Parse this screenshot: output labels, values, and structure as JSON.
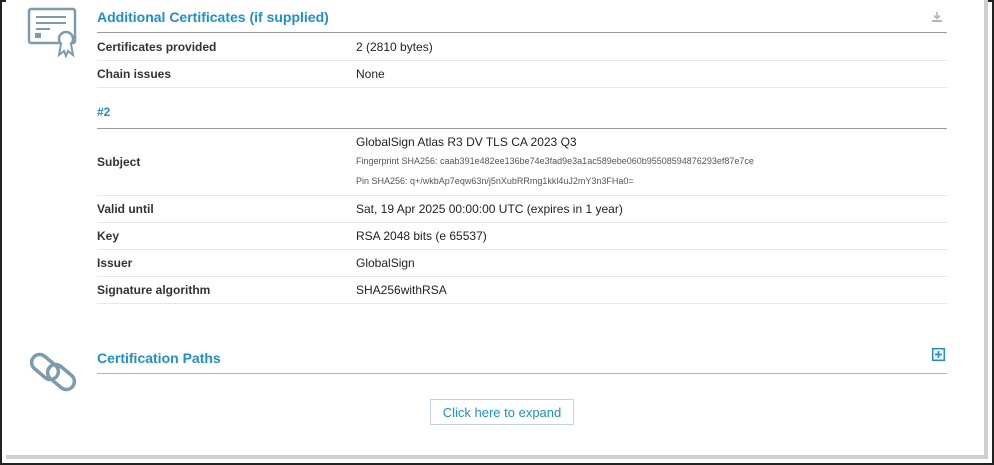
{
  "additional_certificates": {
    "title": "Additional Certificates (if supplied)",
    "rows": [
      {
        "label": "Certificates provided",
        "value": "2 (2810 bytes)"
      },
      {
        "label": "Chain issues",
        "value": "None"
      }
    ],
    "cert2": {
      "heading": "#2",
      "subject_label": "Subject",
      "subject_value": "GlobalSign Atlas R3 DV TLS CA 2023 Q3",
      "fingerprint": "Fingerprint SHA256: caab391e482ee136be74e3fad9e3a1ac589ebe060b95508594876293ef87e7ce",
      "pin": "Pin SHA256: q+/wkbAp7eqw63n/j5nXubRRmg1kkl4uJ2mY3n3FHa0=",
      "rows": [
        {
          "label": "Valid until",
          "value": "Sat, 19 Apr 2025 00:00:00 UTC (expires in 1 year)"
        },
        {
          "label": "Key",
          "value": "RSA 2048 bits (e 65537)"
        },
        {
          "label": "Issuer",
          "value": "GlobalSign"
        },
        {
          "label": "Signature algorithm",
          "value": "SHA256withRSA"
        }
      ]
    }
  },
  "certification_paths": {
    "title": "Certification Paths",
    "expand_label": "Click here to expand"
  },
  "icons": {
    "certificate": "certificate-icon",
    "download": "download-icon",
    "chain_link": "chain-link-icon",
    "expand": "plus-box-icon"
  },
  "colors": {
    "accent": "#1f8fcc",
    "icon_gray": "#7d9aae"
  }
}
